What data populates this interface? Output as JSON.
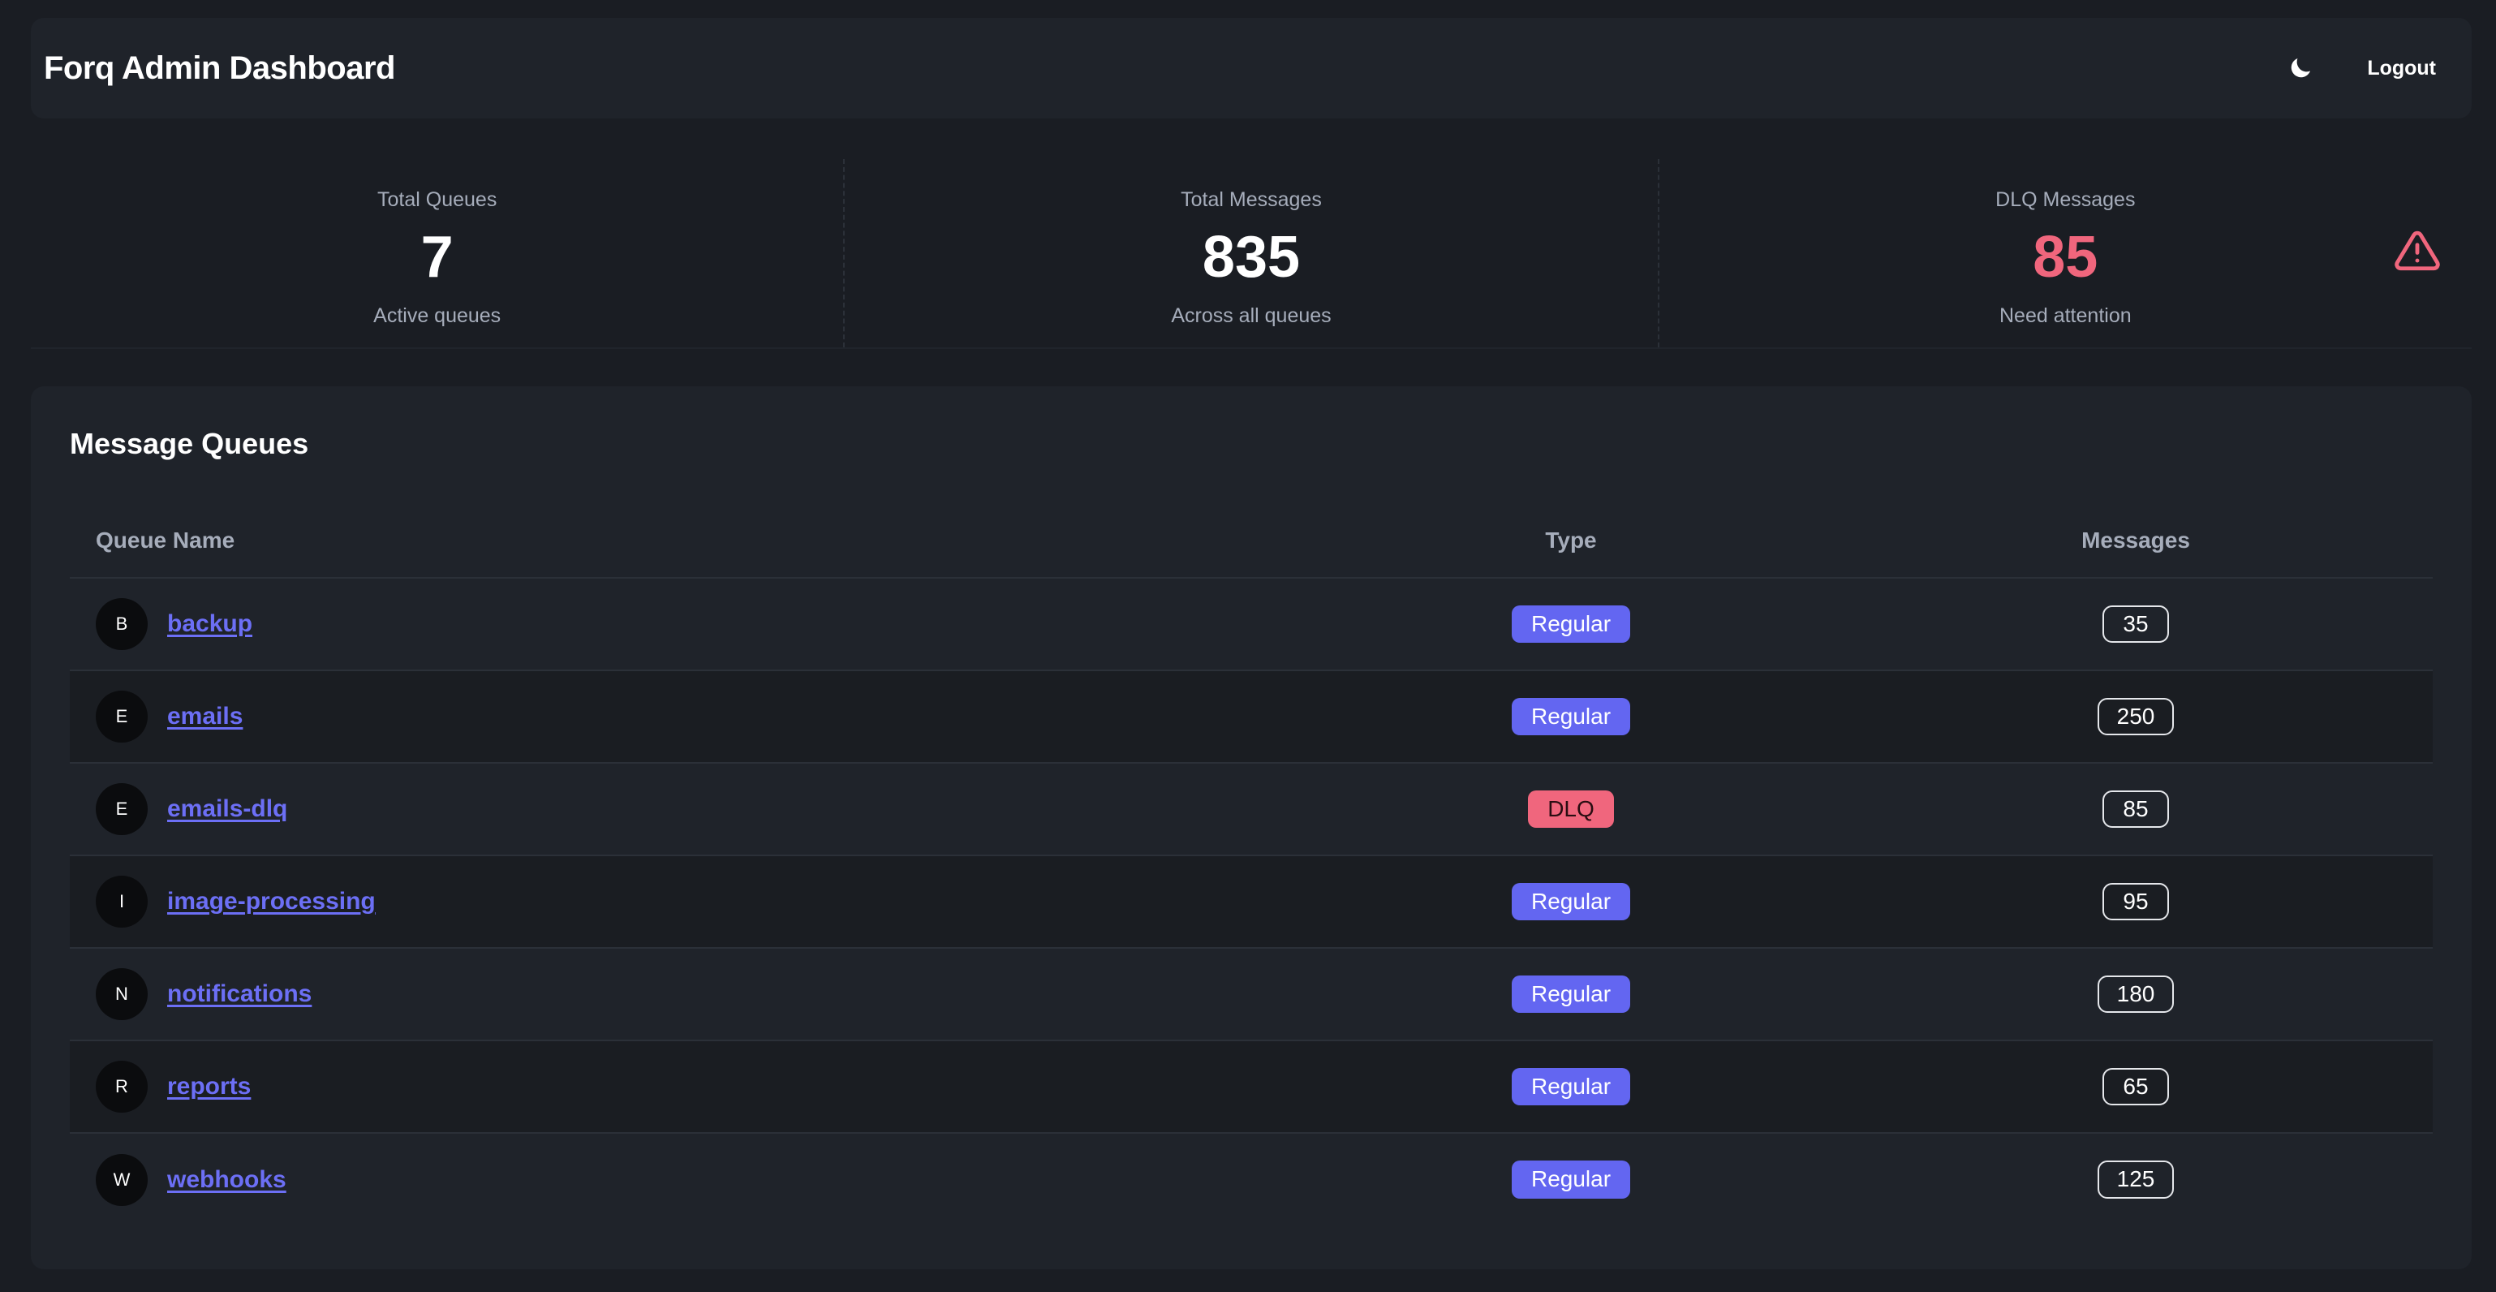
{
  "header": {
    "title": "Forq Admin Dashboard",
    "theme_icon": "moon-icon",
    "logout_label": "Logout"
  },
  "stats": [
    {
      "label": "Total Queues",
      "value": "7",
      "desc": "Active queues"
    },
    {
      "label": "Total Messages",
      "value": "835",
      "desc": "Across all queues"
    },
    {
      "label": "DLQ Messages",
      "value": "85",
      "desc": "Need attention",
      "icon": "warning-triangle-icon",
      "color": "#f0667d"
    }
  ],
  "queues": {
    "title": "Message Queues",
    "columns": {
      "name": "Queue Name",
      "type": "Type",
      "messages": "Messages"
    },
    "rows": [
      {
        "initial": "B",
        "name": "backup",
        "type": "Regular",
        "messages": "35"
      },
      {
        "initial": "E",
        "name": "emails",
        "type": "Regular",
        "messages": "250"
      },
      {
        "initial": "E",
        "name": "emails-dlq",
        "type": "DLQ",
        "messages": "85"
      },
      {
        "initial": "I",
        "name": "image-processing",
        "type": "Regular",
        "messages": "95"
      },
      {
        "initial": "N",
        "name": "notifications",
        "type": "Regular",
        "messages": "180"
      },
      {
        "initial": "R",
        "name": "reports",
        "type": "Regular",
        "messages": "65"
      },
      {
        "initial": "W",
        "name": "webhooks",
        "type": "Regular",
        "messages": "125"
      }
    ]
  },
  "colors": {
    "background": "#1a1d23",
    "card": "#1f232a",
    "accent": "#6366f1",
    "link": "#6c6ff5",
    "danger": "#f0667d"
  }
}
